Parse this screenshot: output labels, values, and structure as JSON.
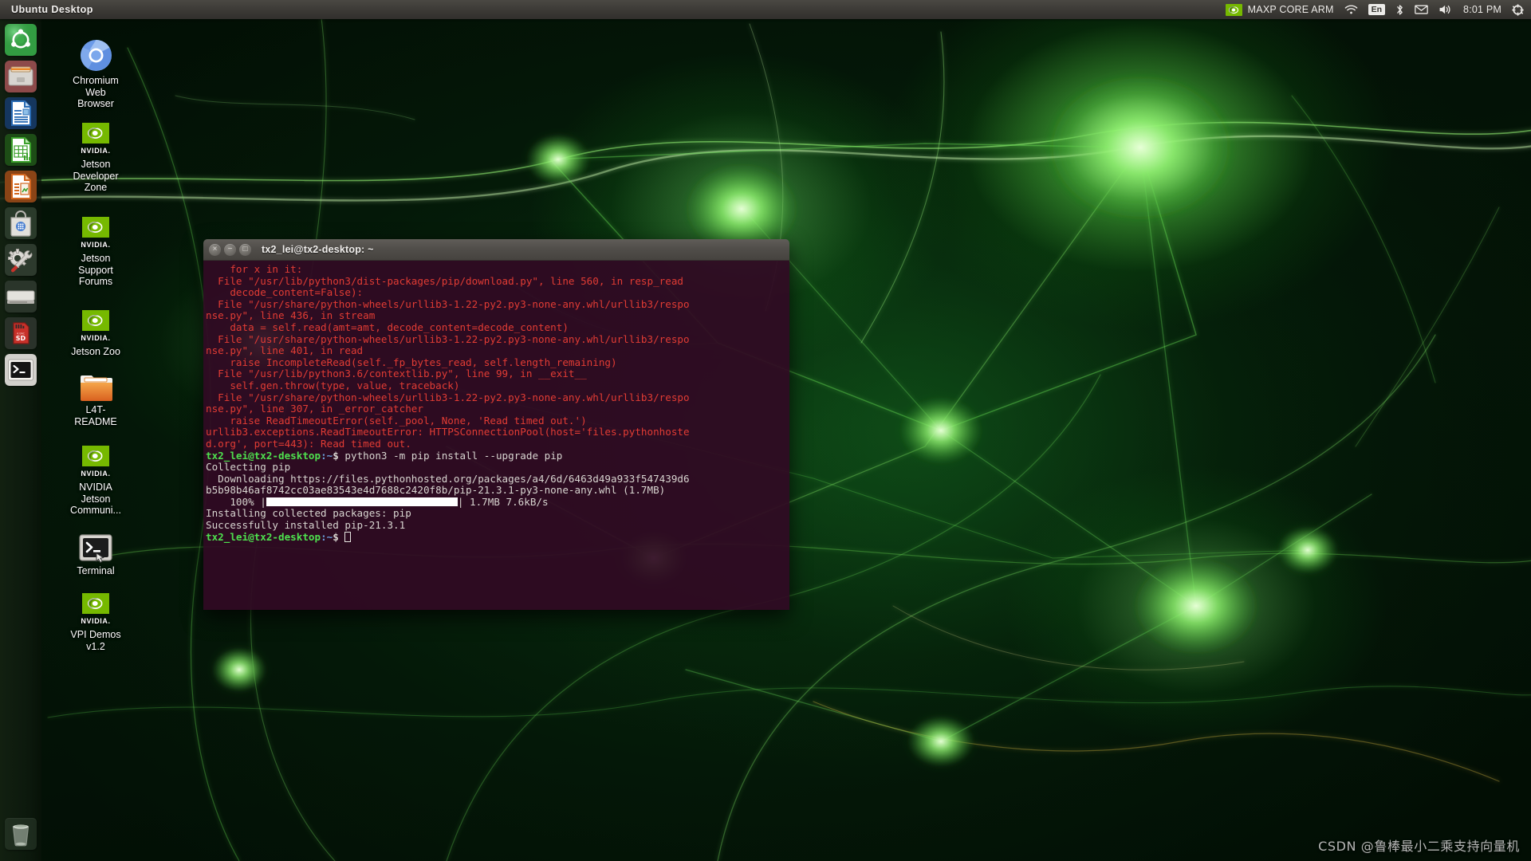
{
  "panel": {
    "title": "Ubuntu Desktop",
    "indicators": {
      "nvidia_icon": "nvidia-eye-icon",
      "nvidia_label": "MAXP CORE ARM",
      "wifi_icon": "wifi-icon",
      "keyboard_label": "En",
      "bluetooth_icon": "bluetooth-icon",
      "mail_icon": "envelope-icon",
      "volume_icon": "speaker-icon",
      "clock": "8:01 PM",
      "session_icon": "gear-power-icon"
    }
  },
  "launcher": {
    "items": [
      {
        "name": "ubuntu-dash",
        "icon": "ubuntu-logo-icon",
        "running": false
      },
      {
        "name": "files",
        "icon": "file-manager-icon",
        "running": true
      },
      {
        "name": "libreoffice-writer",
        "icon": "writer-document-icon",
        "running": false
      },
      {
        "name": "libreoffice-calc",
        "icon": "calc-spreadsheet-icon",
        "running": false
      },
      {
        "name": "libreoffice-impress",
        "icon": "impress-presentation-icon",
        "running": false
      },
      {
        "name": "ubuntu-software",
        "icon": "software-center-bag-icon",
        "running": false
      },
      {
        "name": "system-settings",
        "icon": "gear-wrench-icon",
        "running": false
      },
      {
        "name": "disk-drive",
        "icon": "hard-drive-icon",
        "running": false
      },
      {
        "name": "sd-card",
        "icon": "sd-card-icon",
        "running": false
      },
      {
        "name": "terminal",
        "icon": "terminal-icon",
        "running": true
      },
      {
        "name": "trash",
        "icon": "trash-bin-icon",
        "running": false
      }
    ]
  },
  "desktop_icons": [
    {
      "label": "Chromium Web Browser",
      "icon": "chromium-icon"
    },
    {
      "label": "NVIDIA Jetson Developer Zone",
      "icon": "nvidia-icon"
    },
    {
      "label": "NVIDIA Jetson Support Forums",
      "icon": "nvidia-icon"
    },
    {
      "label": "NVIDIA Jetson Zoo",
      "icon": "nvidia-icon"
    },
    {
      "label": "L4T-README",
      "icon": "folder-icon"
    },
    {
      "label": "NVIDIA NVIDIA Jetson Communi...",
      "icon": "nvidia-icon"
    },
    {
      "label": "Terminal",
      "icon": "terminal-icon"
    },
    {
      "label": "NVIDIA VPI Demos v1.2",
      "icon": "nvidia-icon"
    }
  ],
  "desktop_icon_labels": {
    "chromium": "Chromium\nWeb\nBrowser",
    "jetson_dev_zone": "Jetson\nDeveloper\nZone",
    "jetson_support": "Jetson\nSupport\nForums",
    "jetson_zoo": "Jetson Zoo",
    "l4t_readme": "L4T-\nREADME",
    "jetson_community": "NVIDIA\nJetson\nCommuni...",
    "terminal": "Terminal",
    "vpi_demos": "VPI Demos\nv1.2",
    "nvidia_wordmark": "NVIDIA."
  },
  "terminal": {
    "title": "tx2_lei@tx2-desktop: ~",
    "window_buttons": {
      "close": "×",
      "minimize": "−",
      "maximize": "□"
    },
    "lines": [
      {
        "type": "err",
        "text": "    for x in it:"
      },
      {
        "type": "err",
        "text": "  File \"/usr/lib/python3/dist-packages/pip/download.py\", line 560, in resp_read"
      },
      {
        "type": "err",
        "text": "    decode_content=False):"
      },
      {
        "type": "err",
        "text": "  File \"/usr/share/python-wheels/urllib3-1.22-py2.py3-none-any.whl/urllib3/respo"
      },
      {
        "type": "err",
        "text": "nse.py\", line 436, in stream"
      },
      {
        "type": "err",
        "text": "    data = self.read(amt=amt, decode_content=decode_content)"
      },
      {
        "type": "err",
        "text": "  File \"/usr/share/python-wheels/urllib3-1.22-py2.py3-none-any.whl/urllib3/respo"
      },
      {
        "type": "err",
        "text": "nse.py\", line 401, in read"
      },
      {
        "type": "err",
        "text": "    raise IncompleteRead(self._fp_bytes_read, self.length_remaining)"
      },
      {
        "type": "err",
        "text": "  File \"/usr/lib/python3.6/contextlib.py\", line 99, in __exit__"
      },
      {
        "type": "err",
        "text": "    self.gen.throw(type, value, traceback)"
      },
      {
        "type": "err",
        "text": "  File \"/usr/share/python-wheels/urllib3-1.22-py2.py3-none-any.whl/urllib3/respo"
      },
      {
        "type": "err",
        "text": "nse.py\", line 307, in _error_catcher"
      },
      {
        "type": "err",
        "text": "    raise ReadTimeoutError(self._pool, None, 'Read timed out.')"
      },
      {
        "type": "err",
        "text": "urllib3.exceptions.ReadTimeoutError: HTTPSConnectionPool(host='files.pythonhoste"
      },
      {
        "type": "err",
        "text": "d.org', port=443): Read timed out."
      },
      {
        "type": "cmd",
        "user": "tx2_lei@tx2-desktop",
        "path": ":~",
        "sym": "$ ",
        "cmd": "python3 -m pip install --upgrade pip"
      },
      {
        "type": "out",
        "text": "Collecting pip"
      },
      {
        "type": "out",
        "text": "  Downloading https://files.pythonhosted.org/packages/a4/6d/6463d49a933f547439d6"
      },
      {
        "type": "out",
        "text": "b5b98b46af8742cc03ae83543e4d7688c2420f8b/pip-21.3.1-py3-none-any.whl (1.7MB)"
      },
      {
        "type": "progress",
        "prefix": "    100% |",
        "suffix": "| 1.7MB 7.6kB/s"
      },
      {
        "type": "out",
        "text": "Installing collected packages: pip"
      },
      {
        "type": "out",
        "text": "Successfully installed pip-21.3.1"
      },
      {
        "type": "cmd_cursor",
        "user": "tx2_lei@tx2-desktop",
        "path": ":~",
        "sym": "$ "
      }
    ]
  },
  "watermark": {
    "text": "CSDN @鲁棒最小二乘支持向量机"
  },
  "colors": {
    "nvidia_green": "#76b900",
    "panel_bg": "#3c3a36",
    "terminal_bg": "#300a24",
    "error_red": "#e23c34",
    "prompt_green": "#4ee04e"
  }
}
